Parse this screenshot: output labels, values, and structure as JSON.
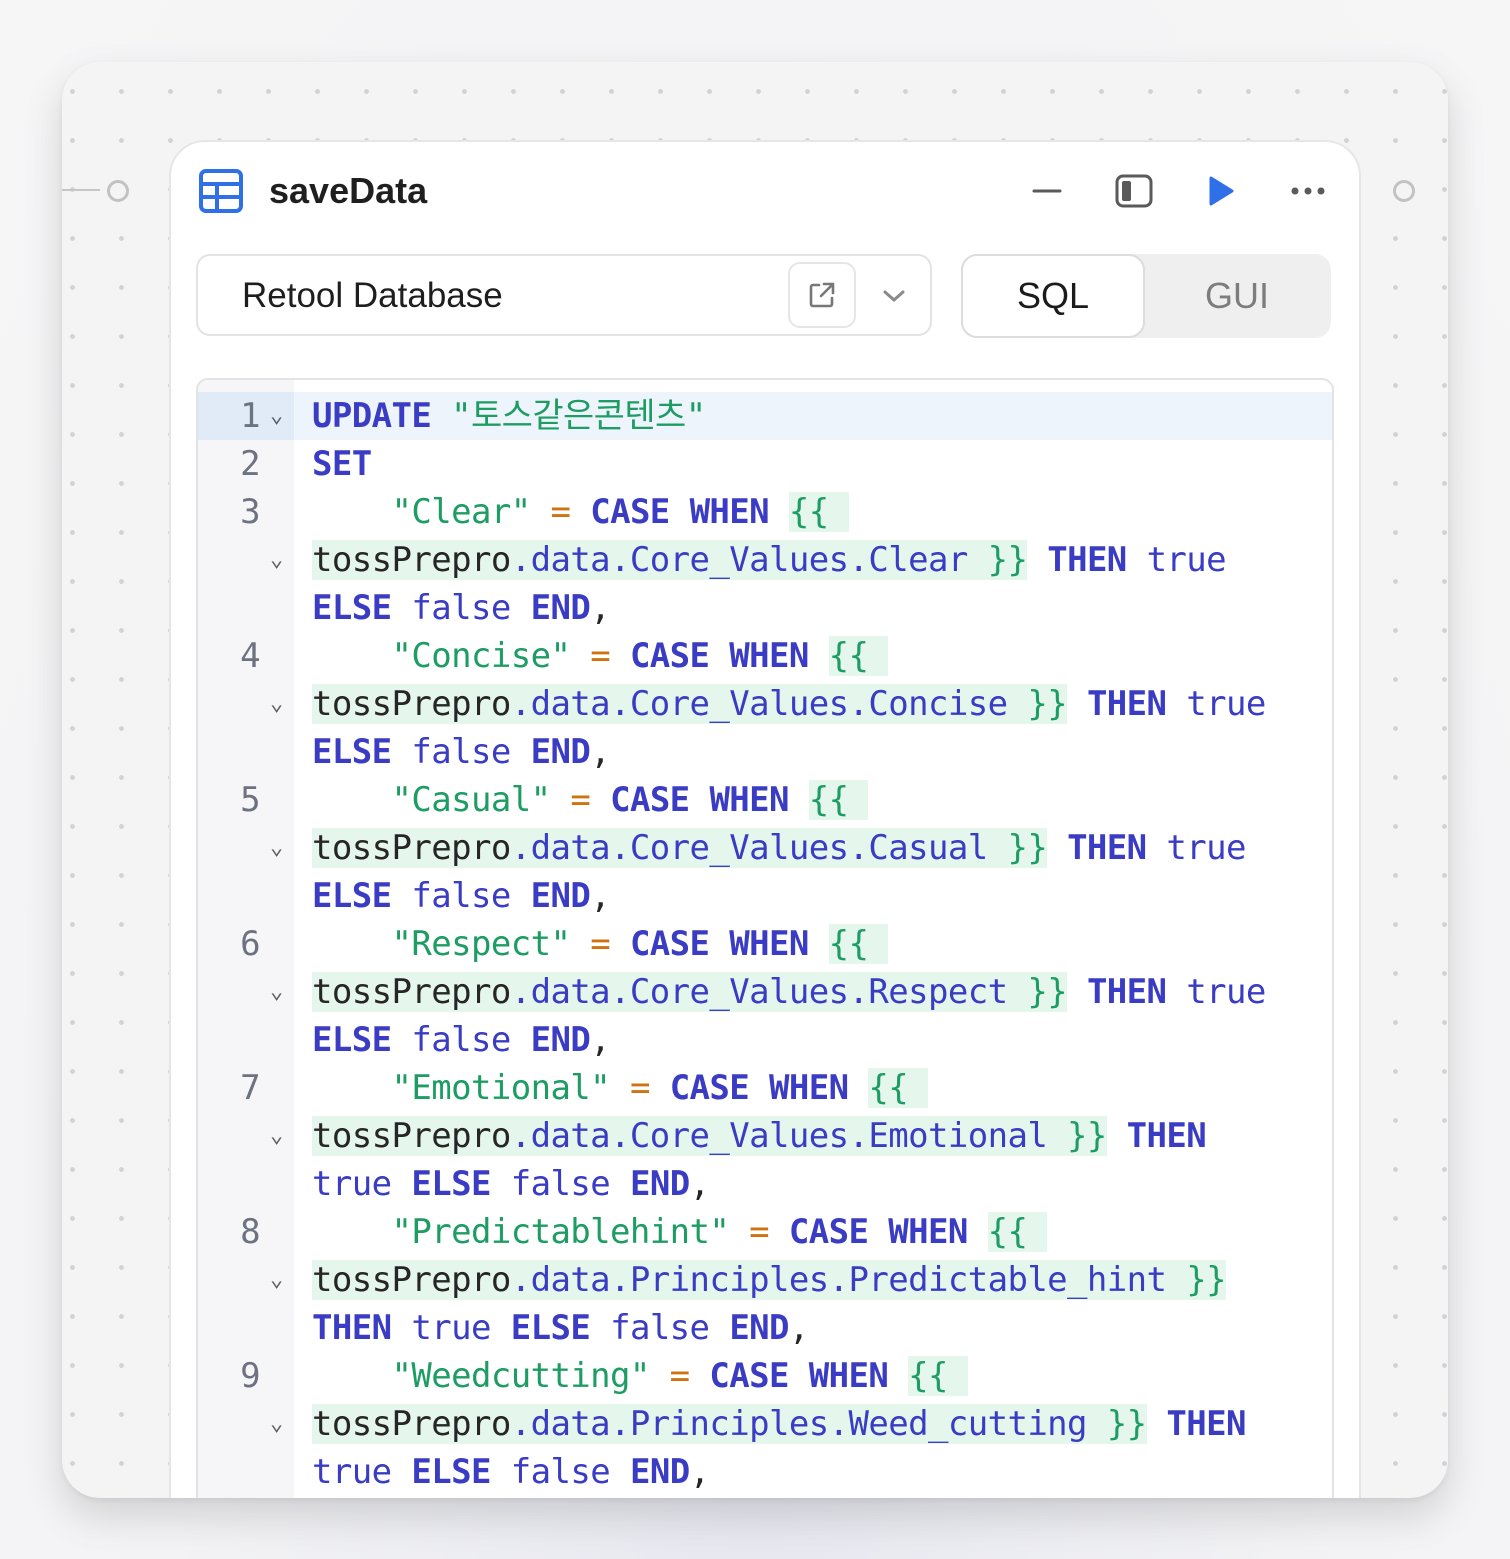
{
  "query": {
    "name": "saveData",
    "resource": "Retool Database",
    "modes": [
      "SQL",
      "GUI"
    ],
    "active_mode": "SQL"
  },
  "editor": {
    "table": "\"토스같은콘텐츠\"",
    "columns": [
      {
        "name": "\"Clear\"",
        "path": ".data.Core_Values.Clear"
      },
      {
        "name": "\"Concise\"",
        "path": ".data.Core_Values.Concise"
      },
      {
        "name": "\"Casual\"",
        "path": ".data.Core_Values.Casual"
      },
      {
        "name": "\"Respect\"",
        "path": ".data.Core_Values.Respect"
      },
      {
        "name": "\"Emotional\"",
        "path": ".data.Core_Values.Emotional"
      },
      {
        "name": "\"Predictablehint\"",
        "path": ".data.Principles.Predictable_hint"
      },
      {
        "name": "\"Weedcutting\"",
        "path": ".data.Principles.Weed_cutting"
      }
    ],
    "source": "tossPrepro"
  },
  "icons": {
    "query_type": "table-icon",
    "minimize": "minus-icon",
    "panel": "sidebar-panel-icon",
    "run": "play-icon",
    "more": "more-icon",
    "open": "external-link-icon",
    "dropdown": "chevron-down-icon"
  },
  "colors": {
    "keyword": "#3a3cc4",
    "string": "#1d9d63",
    "operator": "#cf7310",
    "run": "#2f6fe8",
    "template_bg": "#e5f6ec"
  }
}
